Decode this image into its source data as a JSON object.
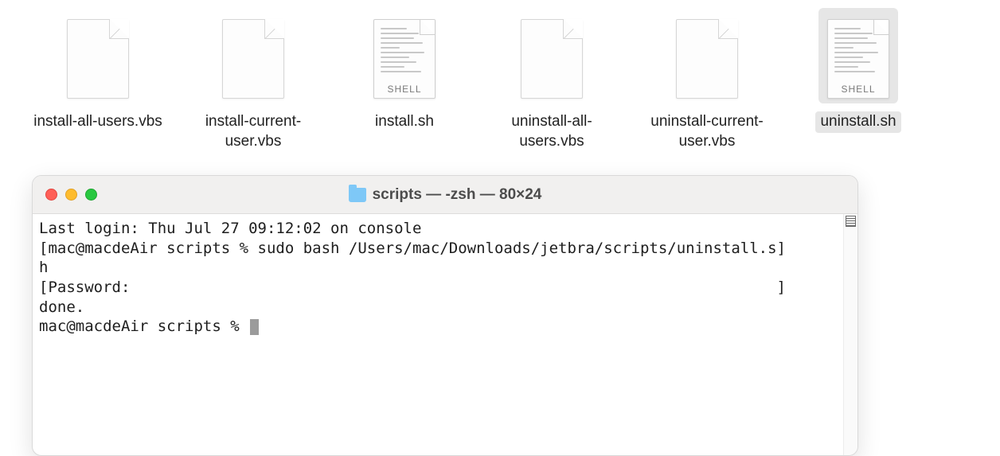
{
  "files": [
    {
      "name": "install-all-users.vbs",
      "icon": "blank",
      "selected": false
    },
    {
      "name": "install-current-user.vbs",
      "icon": "blank",
      "selected": false
    },
    {
      "name": "install.sh",
      "icon": "shell",
      "selected": false
    },
    {
      "name": "uninstall-all-users.vbs",
      "icon": "blank",
      "selected": false
    },
    {
      "name": "uninstall-current-user.vbs",
      "icon": "blank",
      "selected": false
    },
    {
      "name": "uninstall.sh",
      "icon": "shell",
      "selected": true
    }
  ],
  "shell_icon_tag": "SHELL",
  "terminal": {
    "title": "scripts — -zsh — 80×24",
    "lines": {
      "l0": "Last login: Thu Jul 27 09:12:02 on console",
      "l1": "[mac@macdeAir scripts % sudo bash /Users/mac/Downloads/jetbra/scripts/uninstall.s]",
      "l2": "h",
      "l3": "[Password:                                                                       ]",
      "l4": "done.",
      "l5_prompt": "mac@macdeAir scripts % "
    }
  }
}
